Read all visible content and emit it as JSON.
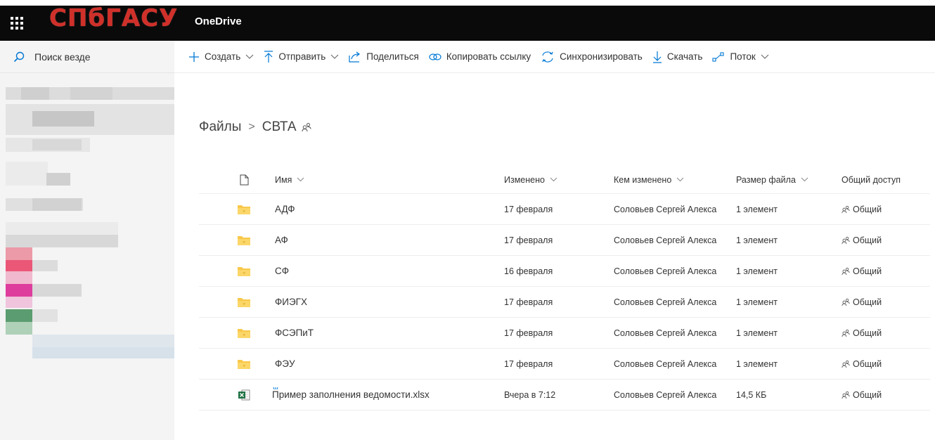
{
  "topbar": {
    "logo_text": "СПбГАСУ",
    "app_title": "OneDrive",
    "waffle_icon": "app-launcher-icon",
    "brand_color": "#d0302a"
  },
  "search": {
    "placeholder": "Поиск везде"
  },
  "commands": [
    {
      "label": "Создать",
      "icon": "plus-icon",
      "dropdown": true
    },
    {
      "label": "Отправить",
      "icon": "upload-icon",
      "dropdown": true
    },
    {
      "label": "Поделиться",
      "icon": "share-icon",
      "dropdown": false
    },
    {
      "label": "Копировать ссылку",
      "icon": "link-icon",
      "dropdown": false
    },
    {
      "label": "Синхронизировать",
      "icon": "sync-icon",
      "dropdown": false
    },
    {
      "label": "Скачать",
      "icon": "download-icon",
      "dropdown": false
    },
    {
      "label": "Поток",
      "icon": "flow-icon",
      "dropdown": true
    }
  ],
  "breadcrumb": {
    "root": "Файлы",
    "separator": ">",
    "current": "СВТА"
  },
  "columns": {
    "name": "Имя",
    "modified": "Изменено",
    "modified_by": "Кем изменено",
    "size": "Размер файла",
    "sharing": "Общий доступ"
  },
  "files": [
    {
      "name": "АДФ",
      "type": "folder",
      "modified": "17 февраля",
      "modified_by": "Соловьев Сергей Алекса",
      "size": "1 элемент",
      "sharing": "Общий"
    },
    {
      "name": "АФ",
      "type": "folder",
      "modified": "17 февраля",
      "modified_by": "Соловьев Сергей Алекса",
      "size": "1 элемент",
      "sharing": "Общий"
    },
    {
      "name": "СФ",
      "type": "folder",
      "modified": "16 февраля",
      "modified_by": "Соловьев Сергей Алекса",
      "size": "1 элемент",
      "sharing": "Общий"
    },
    {
      "name": "ФИЭГХ",
      "type": "folder",
      "modified": "17 февраля",
      "modified_by": "Соловьев Сергей Алекса",
      "size": "1 элемент",
      "sharing": "Общий"
    },
    {
      "name": "ФСЭПиТ",
      "type": "folder",
      "modified": "17 февраля",
      "modified_by": "Соловьев Сергей Алекса",
      "size": "1 элемент",
      "sharing": "Общий"
    },
    {
      "name": "ФЭУ",
      "type": "folder",
      "modified": "17 февраля",
      "modified_by": "Соловьев Сергей Алекса",
      "size": "1 элемент",
      "sharing": "Общий"
    },
    {
      "name": "Пример заполнения ведомости.xlsx",
      "type": "excel",
      "modified": "Вчера в 7:12",
      "modified_by": "Соловьев Сергей Алекса",
      "size": "14,5 КБ",
      "sharing": "Общий"
    }
  ],
  "colors": {
    "accent": "#0078d4",
    "folder": "#f8c84a",
    "excel": "#1f7244"
  }
}
